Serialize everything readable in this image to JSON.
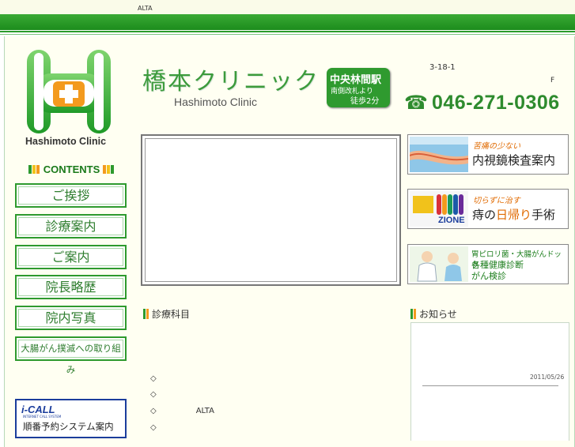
{
  "topbar": {
    "text": "ALTA"
  },
  "logo": {
    "name": "Hashimoto Clinic"
  },
  "header": {
    "title_jp": "橋本クリニック",
    "title_en": "Hashimoto Clinic",
    "station": {
      "name": "中央林間駅",
      "exit": "南側改札より",
      "walk": "徒歩2分"
    },
    "address": "3-18-1",
    "address_floor": "F",
    "phone_icon": "☎",
    "phone": "046-271-0306"
  },
  "sidebar": {
    "contents_heading": "CONTENTS",
    "items": [
      {
        "label": "ご挨拶"
      },
      {
        "label": "診療案内"
      },
      {
        "label": "ご案内"
      },
      {
        "label": "院長略歴"
      },
      {
        "label": "院内写真"
      },
      {
        "label": "大腸がん撲滅への取り組み"
      }
    ],
    "icall": {
      "logo": "i-CALL",
      "sub": "INTERNET CALL SYSTEM",
      "label": "順番予約システム案内"
    }
  },
  "banners": [
    {
      "small": "苦痛の少ない",
      "big": "内視鏡検査案内"
    },
    {
      "small": "切らずに治す",
      "big_pre": "痔の",
      "big_accent": "日帰り",
      "big_post": "手術",
      "thumb_text": "ZIONE"
    },
    {
      "line1": "胃ピロリ菌・大腸がんドック",
      "line2": "各種健康診断",
      "line3": "がん検診"
    }
  ],
  "sections": {
    "departments": {
      "title": "診療科目",
      "bullet": "◇",
      "items": [
        "",
        "",
        "ALTA",
        ""
      ]
    },
    "news": {
      "title": "お知らせ",
      "date": "2011/05/26"
    }
  },
  "colors": {
    "brand_green": "#2e9a2e",
    "accent_orange": "#f39a1e",
    "accent_yellow": "#f1c21b",
    "phone_green": "#2e8b2e"
  }
}
